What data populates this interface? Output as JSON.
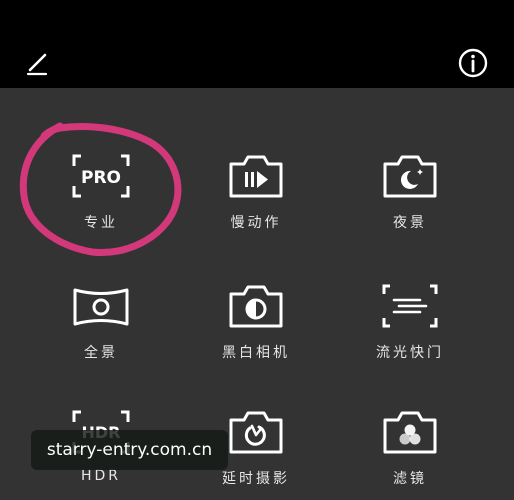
{
  "modes": [
    {
      "label": "专业",
      "icon": "pro-icon",
      "badge": "PRO"
    },
    {
      "label": "慢动作",
      "icon": "slow-motion-icon"
    },
    {
      "label": "夜景",
      "icon": "night-scene-icon"
    },
    {
      "label": "全景",
      "icon": "panorama-icon"
    },
    {
      "label": "黑白相机",
      "icon": "monochrome-icon"
    },
    {
      "label": "流光快门",
      "icon": "light-painting-icon"
    },
    {
      "label": "HDR",
      "icon": "hdr-icon",
      "badge": "HDR"
    },
    {
      "label": "延时摄影",
      "icon": "time-lapse-icon"
    },
    {
      "label": "滤镜",
      "icon": "filter-icon"
    }
  ],
  "watermark": "starry-entry.com.cn",
  "colors": {
    "topbar": "#000000",
    "background": "#333333",
    "icon": "#ffffff",
    "annotation": "#d2387a"
  }
}
